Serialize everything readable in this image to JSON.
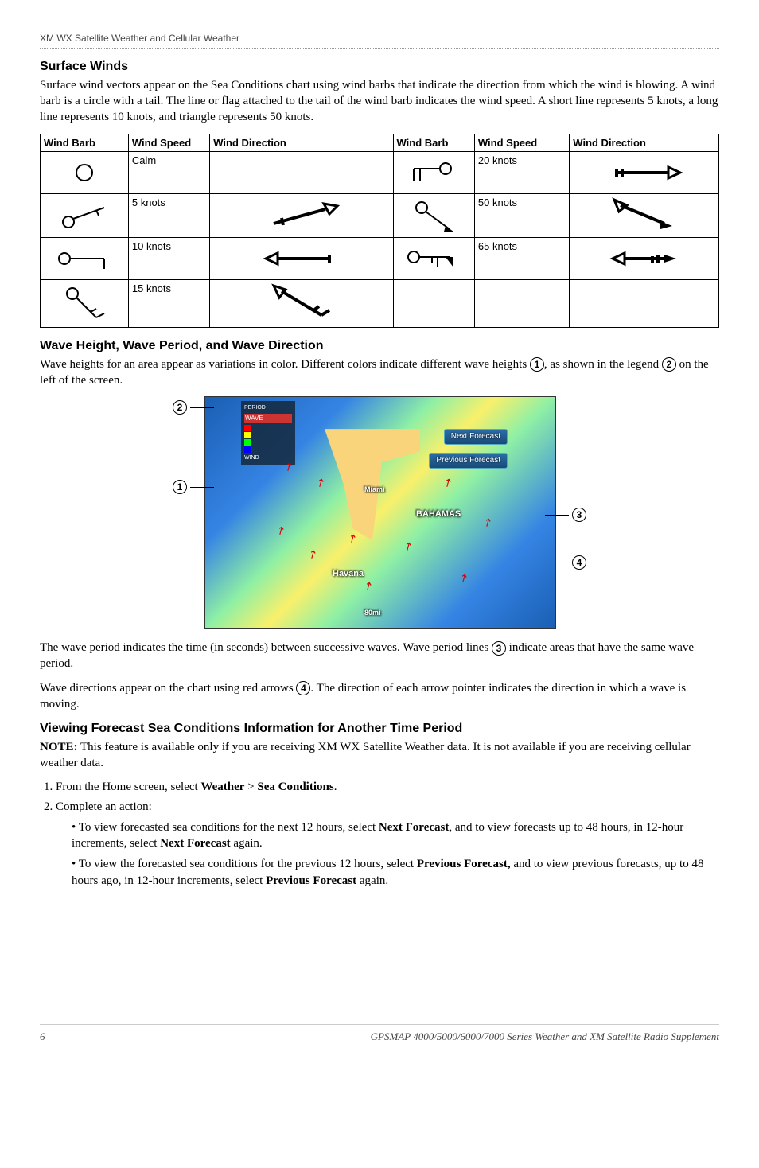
{
  "header": {
    "running_head": "XM WX Satellite Weather and Cellular Weather"
  },
  "section1": {
    "title": "Surface Winds",
    "intro": "Surface wind vectors appear on the Sea Conditions chart using wind barbs that indicate the direction from which the wind is blowing. A wind barb is a circle with a tail. The line or flag attached to the tail of the wind barb indicates the wind speed. A short line represents 5 knots, a long line represents 10 knots, and triangle represents 50 knots."
  },
  "wind_table": {
    "headers": {
      "barb": "Wind Barb",
      "speed": "Wind Speed",
      "dir": "Wind Direction"
    },
    "speeds_left": [
      "Calm",
      "5 knots",
      "10 knots",
      "15 knots"
    ],
    "speeds_right": [
      "20 knots",
      "50 knots",
      "65 knots"
    ]
  },
  "section2": {
    "title": "Wave Height, Wave Period, and Wave Direction",
    "intro_pre": "Wave heights for an area appear as variations in color. Different colors indicate different wave heights ",
    "intro_mid": ", as shown in the legend ",
    "intro_post": " on the left of the screen.",
    "wave_period_pre": "The wave period indicates the time (in seconds) between successive waves. Wave period lines ",
    "wave_period_post": " indicate areas that have the same wave period.",
    "wave_dir_pre": "Wave directions appear on the chart using red arrows ",
    "wave_dir_post": ". The direction of each arrow pointer indicates the direction in which a wave is moving."
  },
  "map": {
    "next_forecast": "Next Forecast",
    "prev_forecast": "Previous Forecast",
    "label_miami": "Miami",
    "label_bahamas": "BAHAMAS",
    "label_havana": "Havana",
    "scale": "80mi",
    "legend_title": "PERIOD",
    "legend_wave": "WAVE",
    "legend_wind": "WIND"
  },
  "section3": {
    "title": "Viewing Forecast Sea Conditions Information for Another Time Period",
    "note_label": "NOTE:",
    "note_text": " This feature is available only if you are receiving XM WX Satellite Weather data. It is not available if you are receiving cellular weather data.",
    "step1_pre": "From the Home screen, select ",
    "step1_b1": "Weather",
    "step1_sep": " > ",
    "step1_b2": "Sea Conditions",
    "step1_post": ".",
    "step2": "Complete an action:",
    "bullet1_pre": "To view forecasted sea conditions for the next 12 hours, select ",
    "bullet1_b1": "Next Forecast",
    "bullet1_mid": ", and to view forecasts up to 48 hours, in 12-hour increments, select ",
    "bullet1_b2": "Next Forecast",
    "bullet1_post": " again.",
    "bullet2_pre": "To view the forecasted sea conditions for the previous 12 hours, select ",
    "bullet2_b1": "Previous Forecast,",
    "bullet2_mid": " and to view previous forecasts, up to 48 hours ago, in 12-hour increments, select ",
    "bullet2_b2": "Previous Forecast",
    "bullet2_post": " again."
  },
  "footer": {
    "page": "6",
    "title": "GPSMAP 4000/5000/6000/7000 Series Weather and XM Satellite Radio Supplement"
  },
  "callouts": {
    "c1": "1",
    "c2": "2",
    "c3": "3",
    "c4": "4"
  }
}
